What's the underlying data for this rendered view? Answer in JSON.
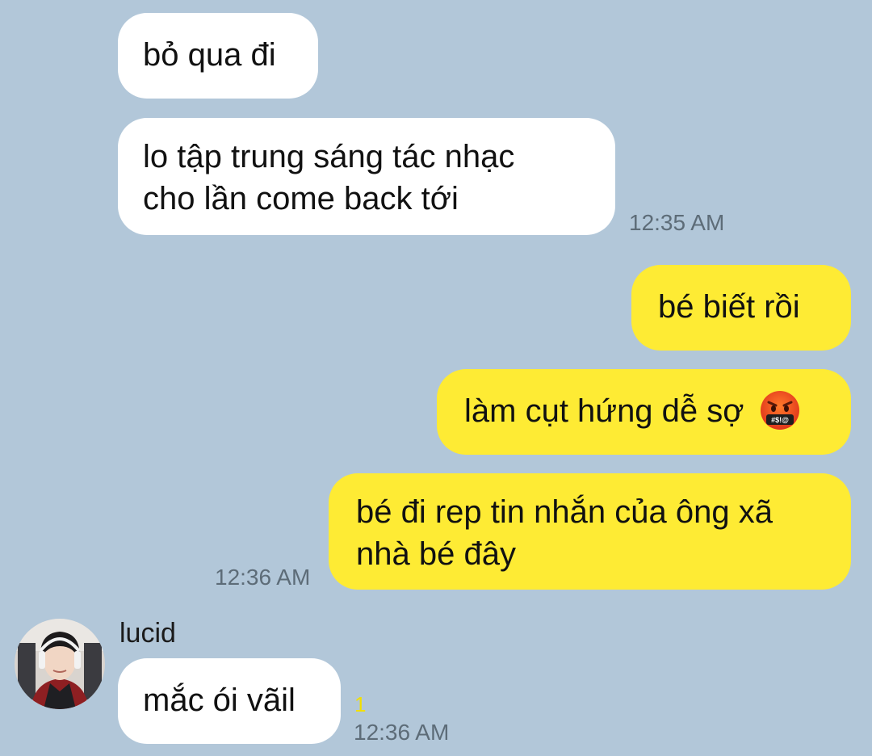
{
  "messages": [
    {
      "dir": "in",
      "text": "bỏ qua đi"
    },
    {
      "dir": "in",
      "lines": [
        "lo tập trung sáng tác nhạc",
        "cho lần come back tới"
      ],
      "time": "12:35 AM"
    },
    {
      "dir": "out",
      "text": "bé biết rồi"
    },
    {
      "dir": "out",
      "text": "làm cụt hứng dễ sợ",
      "emoji": "cursing-face-icon",
      "emoji_text": "#$!@"
    },
    {
      "dir": "out",
      "lines": [
        "bé đi rep tin nhắn của ông xã",
        "nhà bé đây"
      ],
      "time": "12:36 AM"
    },
    {
      "dir": "in",
      "sender": "lucid",
      "text": "mắc ói vãil",
      "unread": "1",
      "time": "12:36 AM"
    }
  ],
  "colors": {
    "background": "#b2c7d9",
    "incoming_bubble": "#ffffff",
    "outgoing_bubble": "#feeb34",
    "timestamp": "#5d6c78",
    "unread": "#f2df00"
  }
}
